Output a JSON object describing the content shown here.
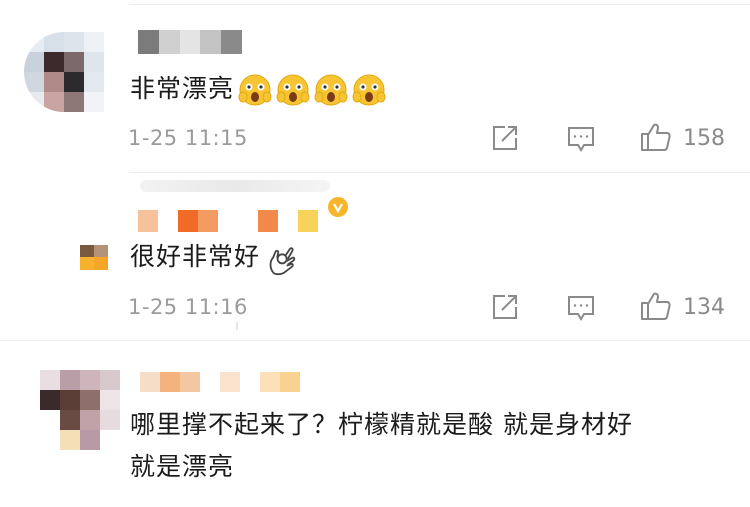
{
  "comments": [
    {
      "text": "非常漂亮",
      "emojis": [
        "shocked-face-icon",
        "shocked-face-icon",
        "shocked-face-icon",
        "shocked-face-icon"
      ],
      "time": "1-25 11:15",
      "likes": "158"
    },
    {
      "text": "很好非常好",
      "emojis": [
        "ok-hand-icon"
      ],
      "time": "1-25 11:16",
      "likes": "134"
    },
    {
      "text_line1": "哪里撑不起来了？柠檬精就是酸  就是身材好",
      "text_line2": "就是漂亮"
    }
  ],
  "colors": {
    "emoji_yellow": "#f7c531",
    "meta_grey": "#9b9b9b",
    "icon_grey": "#8a8a8a",
    "mosaic_orange": "#f08c4a"
  }
}
